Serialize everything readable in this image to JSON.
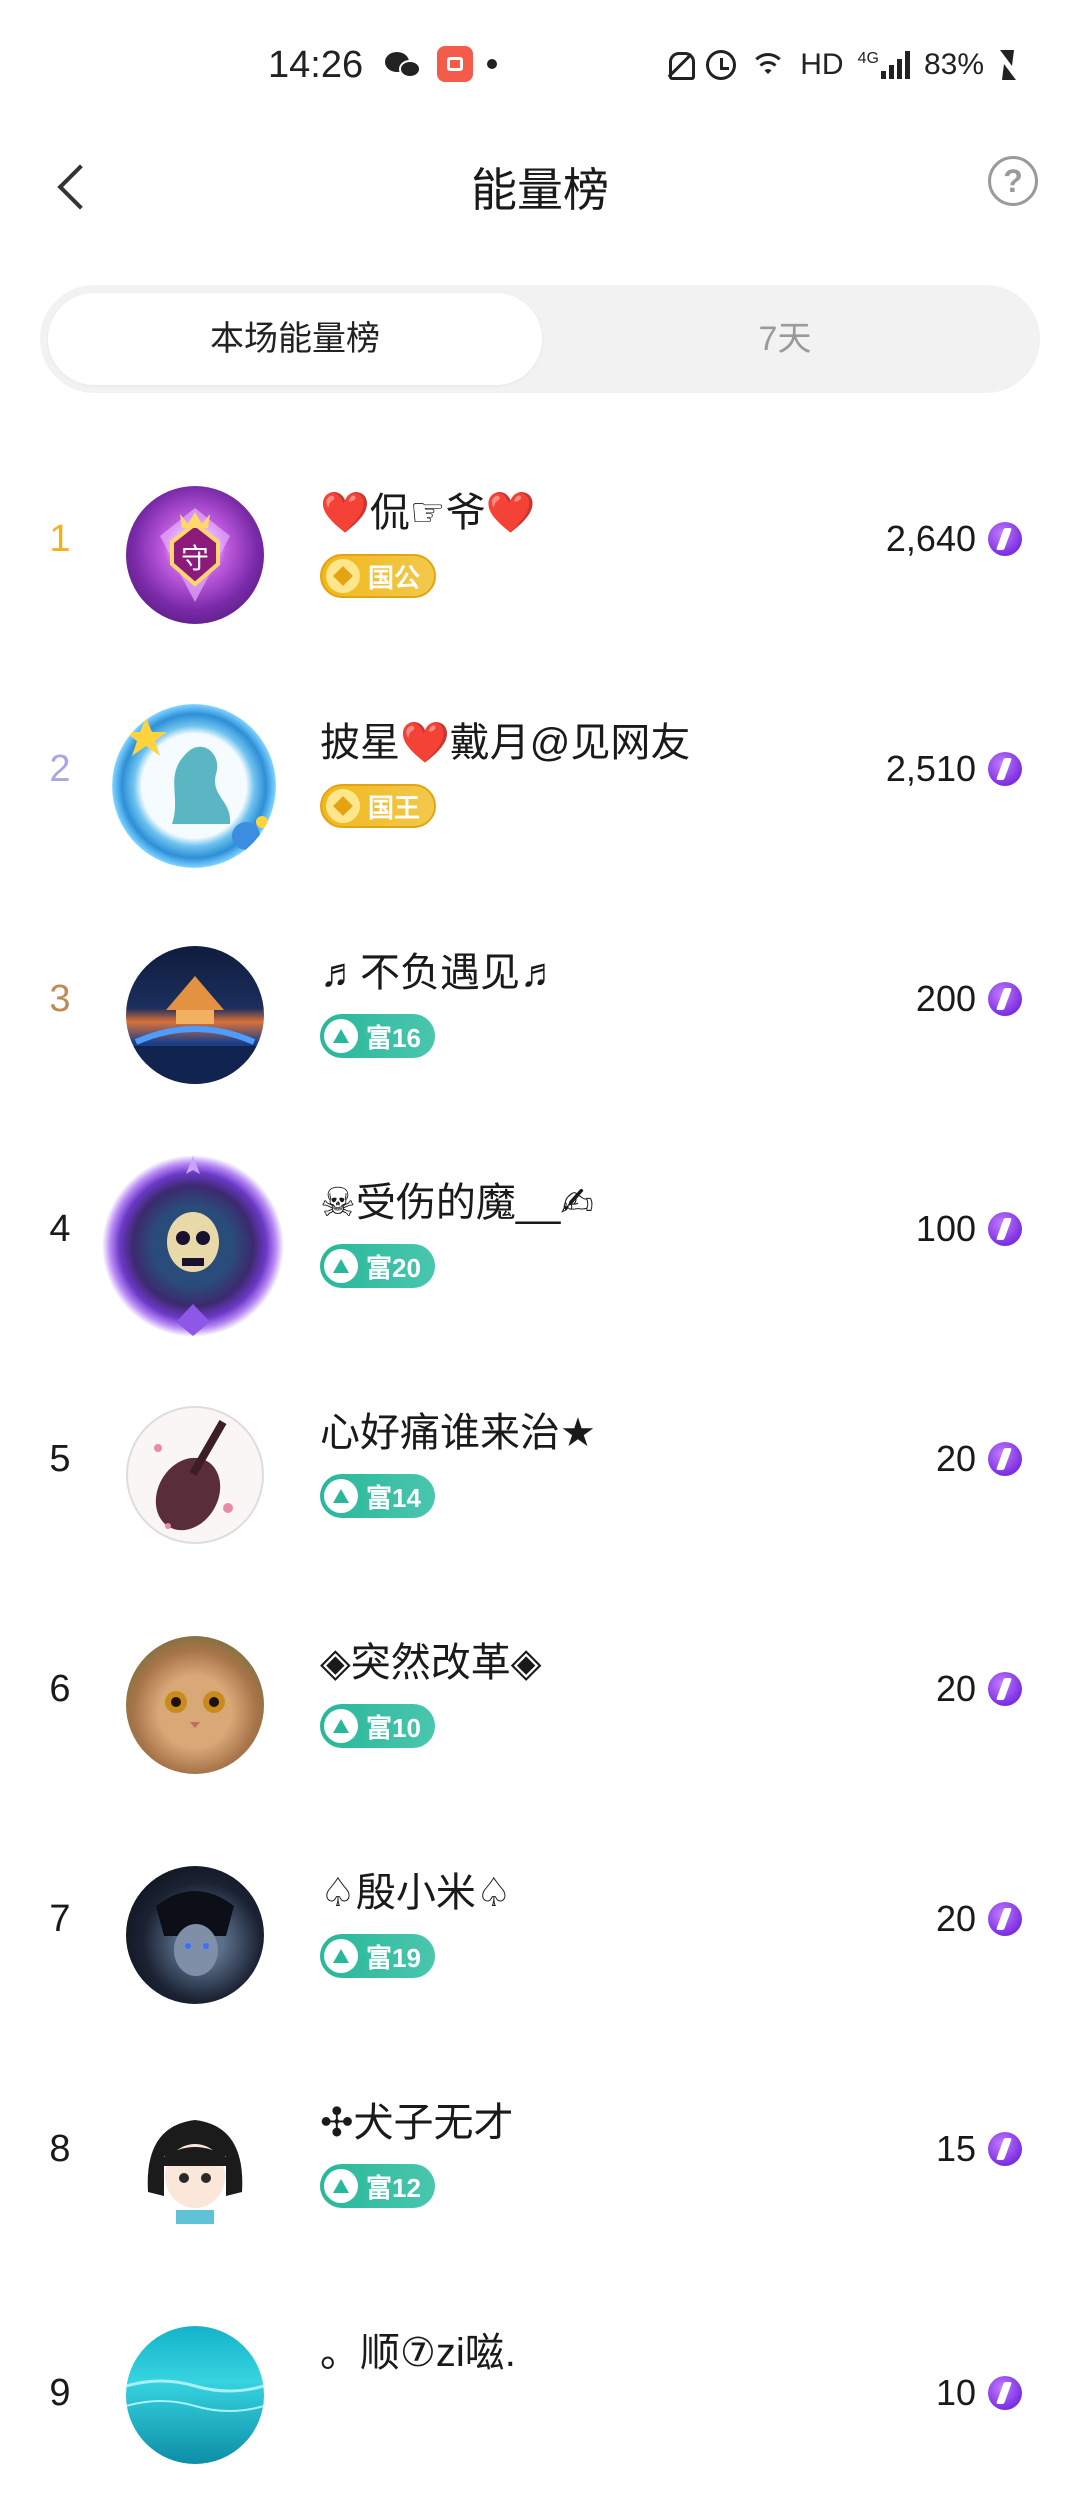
{
  "status_bar": {
    "time": "14:26",
    "network_label": "HD",
    "network_type": "4G",
    "battery": "83%",
    "icons": [
      "wechat-icon",
      "kuaishou-icon",
      "dot-icon",
      "mute-bell-icon",
      "alarm-icon",
      "wifi-icon",
      "signal-icon",
      "charging-icon"
    ]
  },
  "header": {
    "title": "能量榜",
    "help_label": "?"
  },
  "tabs": [
    {
      "label": "本场能量榜",
      "active": true
    },
    {
      "label": "7天",
      "active": false
    }
  ],
  "colors": {
    "rank1": "#f2b01e",
    "rank2": "#a9a6e6",
    "rank3": "#c08a55",
    "rank_default": "#1a1a1a",
    "badge_gold": "#f0b81d",
    "badge_teal": "#28b79a",
    "energy_icon": "#7b2fe0"
  },
  "ranking": [
    {
      "rank": "1",
      "name": "❤️侃☞爷❤️",
      "badge": "国公",
      "badge_style": "gold",
      "energy": "2,640",
      "avatar": "guardian-purple-frame"
    },
    {
      "rank": "2",
      "name": "披星❤️戴月@见网友",
      "badge": "国王",
      "badge_style": "gold",
      "energy": "2,510",
      "avatar": "blue-dragon-frame"
    },
    {
      "rank": "3",
      "name": "♬不负遇见♬",
      "badge": "富16",
      "badge_style": "teal",
      "energy": "200",
      "avatar": "night-city"
    },
    {
      "rank": "4",
      "name": "☠受伤的魔__✍",
      "badge": "富20",
      "badge_style": "teal",
      "energy": "100",
      "avatar": "skull-frame"
    },
    {
      "rank": "5",
      "name": "心好痛谁来治★",
      "badge": "富14",
      "badge_style": "teal",
      "energy": "20",
      "avatar": "pipa-instrument"
    },
    {
      "rank": "6",
      "name": "◈突然改革◈",
      "badge": "富10",
      "badge_style": "teal",
      "energy": "20",
      "avatar": "cat"
    },
    {
      "rank": "7",
      "name": "♤殷小米♤",
      "badge": "富19",
      "badge_style": "teal",
      "energy": "20",
      "avatar": "anime-boy"
    },
    {
      "rank": "8",
      "name": "✣犬子无才",
      "badge": "富12",
      "badge_style": "teal",
      "energy": "15",
      "avatar": "anime-girl"
    },
    {
      "rank": "9",
      "name": "。顺⑦zi嗞.",
      "badge": "",
      "badge_style": "teal",
      "energy": "10",
      "avatar": "ocean"
    }
  ]
}
